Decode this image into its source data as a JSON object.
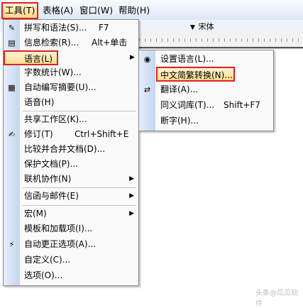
{
  "menubar": {
    "items": [
      {
        "label": "工具(T)"
      },
      {
        "label": "表格(A)"
      },
      {
        "label": "窗口(W)"
      },
      {
        "label": "帮助(H)"
      }
    ]
  },
  "toolbar": {
    "font_name": "宋体",
    "dropdown_glyph": "▼"
  },
  "tools_menu": {
    "items": [
      {
        "label": "拼写和语法(S)...",
        "shortcut": "F7",
        "icon": "spelling-icon"
      },
      {
        "label": "信息检索(R)...",
        "shortcut": "Alt+单击",
        "icon": "research-icon"
      },
      {
        "label": "语言(L)",
        "shortcut": "",
        "icon": "",
        "submenu": true
      },
      {
        "label": "字数统计(W)...",
        "shortcut": "",
        "icon": ""
      },
      {
        "label": "自动编写摘要(U)...",
        "shortcut": "",
        "icon": "summary-icon"
      },
      {
        "label": "语音(H)",
        "shortcut": "",
        "icon": ""
      },
      {
        "label": "共享工作区(K)...",
        "shortcut": "",
        "icon": ""
      },
      {
        "label": "修订(T)",
        "shortcut": "Ctrl+Shift+E",
        "icon": "track-changes-icon"
      },
      {
        "label": "比较并合并文档(D)...",
        "shortcut": "",
        "icon": ""
      },
      {
        "label": "保护文档(P)...",
        "shortcut": "",
        "icon": ""
      },
      {
        "label": "联机协作(N)",
        "shortcut": "",
        "icon": "",
        "submenu": true
      },
      {
        "label": "信函与邮件(E)",
        "shortcut": "",
        "icon": "",
        "submenu": true
      },
      {
        "label": "宏(M)",
        "shortcut": "",
        "icon": "",
        "submenu": true
      },
      {
        "label": "模板和加载项(I)...",
        "shortcut": "",
        "icon": ""
      },
      {
        "label": "自动更正选项(A)...",
        "shortcut": "",
        "icon": "autocorrect-icon"
      },
      {
        "label": "自定义(C)...",
        "shortcut": "",
        "icon": ""
      },
      {
        "label": "选项(O)...",
        "shortcut": "",
        "icon": ""
      }
    ],
    "submenu_arrow": "▶"
  },
  "language_submenu": {
    "items": [
      {
        "label": "设置语言(L)...",
        "shortcut": "",
        "icon": "set-language-icon"
      },
      {
        "label": "中文简繁转换(N)...",
        "shortcut": "",
        "icon": ""
      },
      {
        "label": "翻译(A)...",
        "shortcut": "",
        "icon": "translate-icon"
      },
      {
        "label": "同义词库(T)...",
        "shortcut": "Shift+F7",
        "icon": ""
      },
      {
        "label": "断字(H)...",
        "shortcut": "",
        "icon": ""
      }
    ]
  },
  "watermark": "头条@瓜瓜软件",
  "colors": {
    "highlight_border": "#e02020",
    "menu_strip": "#c4d6ef"
  }
}
